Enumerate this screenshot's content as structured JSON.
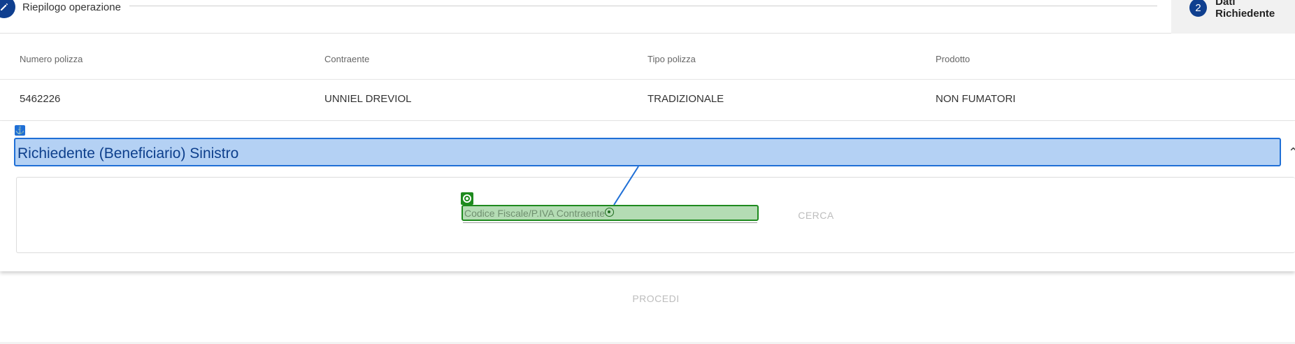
{
  "stepper": {
    "step1": {
      "label": "Riepilogo operazione",
      "icon": "pencil-icon"
    },
    "step2": {
      "number": "2",
      "label": "Dati Richiedente"
    }
  },
  "policy": {
    "headers": [
      "Numero polizza",
      "Contraente",
      "Tipo polizza",
      "Prodotto"
    ],
    "values": [
      "5462226",
      "UNNIEL DREVIOL",
      "TRADIZIONALE",
      "NON FUMATORI"
    ]
  },
  "section": {
    "title": "Richiedente (Beneficiario) Sinistro",
    "anchor_icon": "anchor-icon",
    "toggle_icon": "chevron-up-icon",
    "search_field": {
      "placeholder": "Codice Fiscale/P.IVA Contraente",
      "value": ""
    },
    "search_button": "CERCA"
  },
  "actions": {
    "proceed_label": "PROCEDI"
  },
  "colors": {
    "primary": "#0f3f8f",
    "highlight_blue": "#b4d1f4",
    "highlight_green": "#b4dcb4",
    "disabled_text": "#bdbdbd"
  }
}
